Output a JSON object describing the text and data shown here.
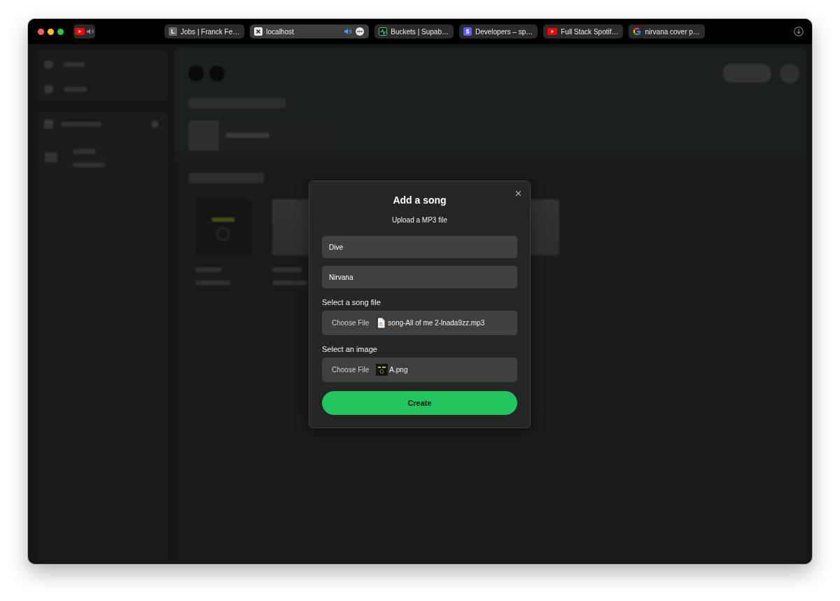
{
  "browser": {
    "pinned_tab": {
      "favicon": {
        "kind": "video"
      },
      "audio": true
    },
    "tabs": [
      {
        "title": "Jobs | Franck Fe…",
        "favicon": {
          "kind": "letter",
          "text": "L",
          "color": "#6e6e6e"
        },
        "audio": false,
        "selected": false
      },
      {
        "title": "localhost",
        "favicon": {
          "kind": "cross-square"
        },
        "audio": true,
        "selected": true
      },
      {
        "title": "Buckets | Supab…",
        "favicon": {
          "kind": "pulse"
        },
        "audio": false,
        "selected": false
      },
      {
        "title": "Developers – sp…",
        "favicon": {
          "kind": "letter",
          "text": "$",
          "color": "#635bff"
        },
        "audio": false,
        "selected": false
      },
      {
        "title": "Full Stack Spotif…",
        "favicon": {
          "kind": "video"
        },
        "audio": false,
        "selected": false
      },
      {
        "title": "nirvana cover p…",
        "favicon": {
          "kind": "g"
        },
        "audio": false,
        "selected": false
      }
    ]
  },
  "modal": {
    "title": "Add a song",
    "subtitle": "Upload a MP3 file",
    "fields": [
      {
        "value": "Dive"
      },
      {
        "value": "Nirvana"
      }
    ],
    "file_inputs": [
      {
        "label": "Select a song file",
        "button": "Choose File",
        "file_name": "song-All of me 2-lnada9zz.mp3",
        "kind": "document"
      },
      {
        "label": "Select an image",
        "button": "Choose File",
        "file_name": "A.png",
        "kind": "image"
      }
    ],
    "submit": "Create"
  }
}
